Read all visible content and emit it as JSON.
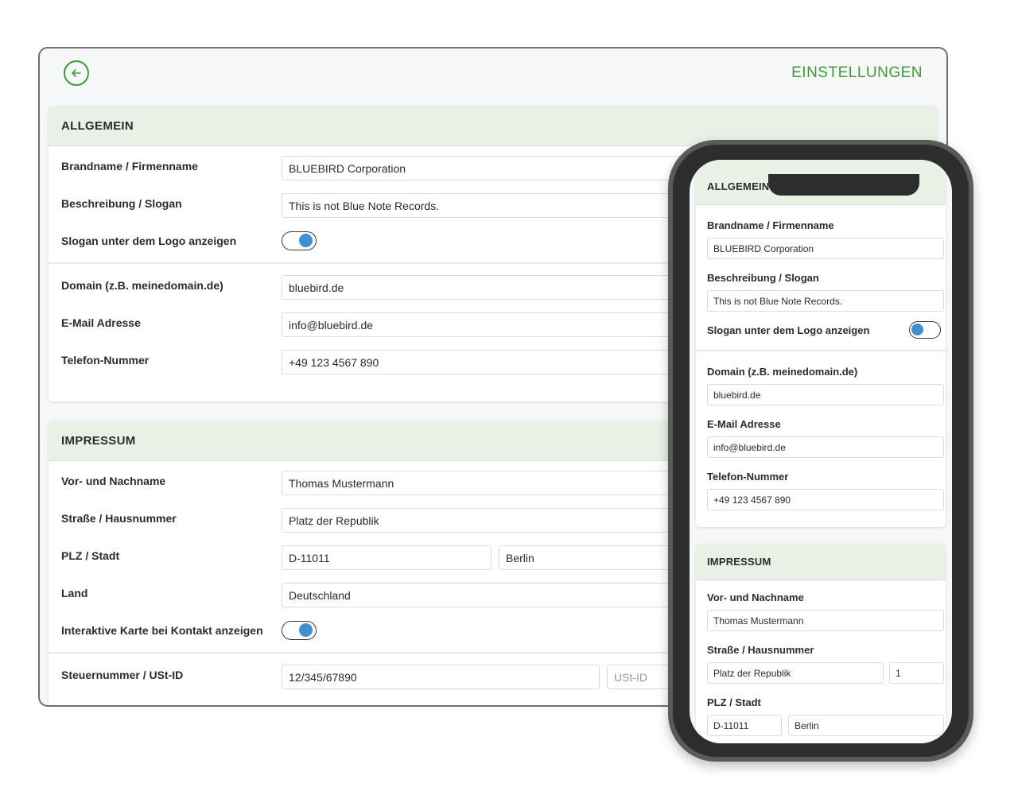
{
  "header": {
    "title": "EINSTELLUNGEN",
    "back_icon": "arrow-left-circle-icon"
  },
  "colors": {
    "accent": "#3f9a36",
    "section_bg": "#e9f1e7",
    "toggle_knob": "#3f8fd2"
  },
  "allgemein": {
    "title": "ALLGEMEIN",
    "brand_label": "Brandname / Firmenname",
    "brand_value": "BLUEBIRD Corporation",
    "slogan_label": "Beschreibung / Slogan",
    "slogan_value": "This is not Blue Note Records.",
    "show_slogan_label": "Slogan unter dem Logo anzeigen",
    "show_slogan_on": true,
    "domain_label": "Domain (z.B. meinedomain.de)",
    "domain_value": "bluebird.de",
    "email_label": "E-Mail Adresse",
    "email_value": "info@bluebird.de",
    "phone_label": "Telefon-Nummer",
    "phone_value": "+49 123 4567 890"
  },
  "impressum": {
    "title": "IMPRESSUM",
    "name_label": "Vor- und Nachname",
    "name_value": "Thomas Mustermann",
    "street_label": "Straße / Hausnummer",
    "street_value": "Platz der Republik",
    "house_number_value": "1",
    "city_label": "PLZ / Stadt",
    "zip_value": "D-11011",
    "city_value": "Berlin",
    "country_label": "Land",
    "country_value": "Deutschland",
    "map_label": "Interaktive Karte bei Kontakt anzeigen",
    "map_on": true,
    "tax_label": "Steuernummer / USt-ID",
    "tax_value": "12/345/67890",
    "vat_placeholder": "USt-ID"
  }
}
